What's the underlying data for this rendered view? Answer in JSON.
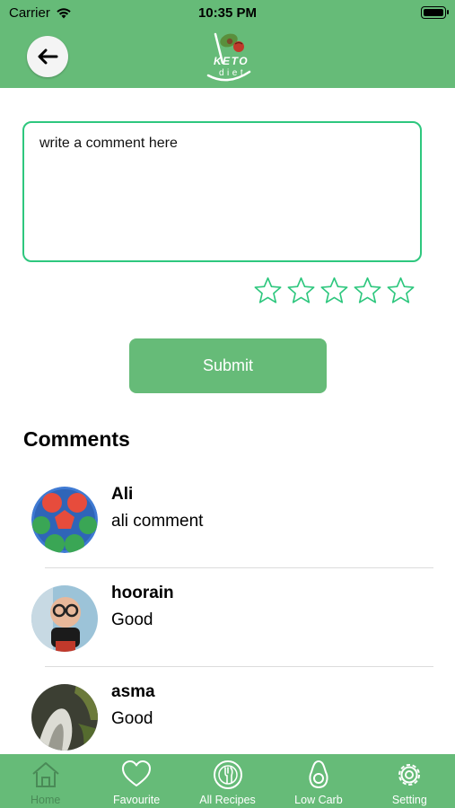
{
  "status_bar": {
    "carrier": "Carrier",
    "time": "10:35 PM"
  },
  "header": {
    "back_icon": "arrow-left-icon",
    "logo_text_top": "KETO",
    "logo_text_bottom": "diet",
    "color": "#66bb78"
  },
  "comment_input": {
    "placeholder": "write a comment here",
    "border_color": "#2ec77e"
  },
  "rating": {
    "max": 5,
    "value": 0
  },
  "submit": {
    "label": "Submit"
  },
  "comments": {
    "title": "Comments",
    "items": [
      {
        "name": "Ali",
        "text": "ali comment",
        "avatar": "soccer-ball-avatar"
      },
      {
        "name": "hoorain",
        "text": "Good",
        "avatar": "baby-photo-avatar"
      },
      {
        "name": "asma",
        "text": "Good",
        "avatar": "photo-avatar"
      }
    ]
  },
  "tabbar": {
    "items": [
      {
        "label": "Home",
        "icon": "home-icon",
        "active": true
      },
      {
        "label": "Favourite",
        "icon": "heart-icon",
        "active": false
      },
      {
        "label": "All Recipes",
        "icon": "plate-fork-knife-icon",
        "active": false
      },
      {
        "label": "Low Carb",
        "icon": "avocado-icon",
        "active": false
      },
      {
        "label": "Setting",
        "icon": "gear-icon",
        "active": false
      }
    ]
  }
}
